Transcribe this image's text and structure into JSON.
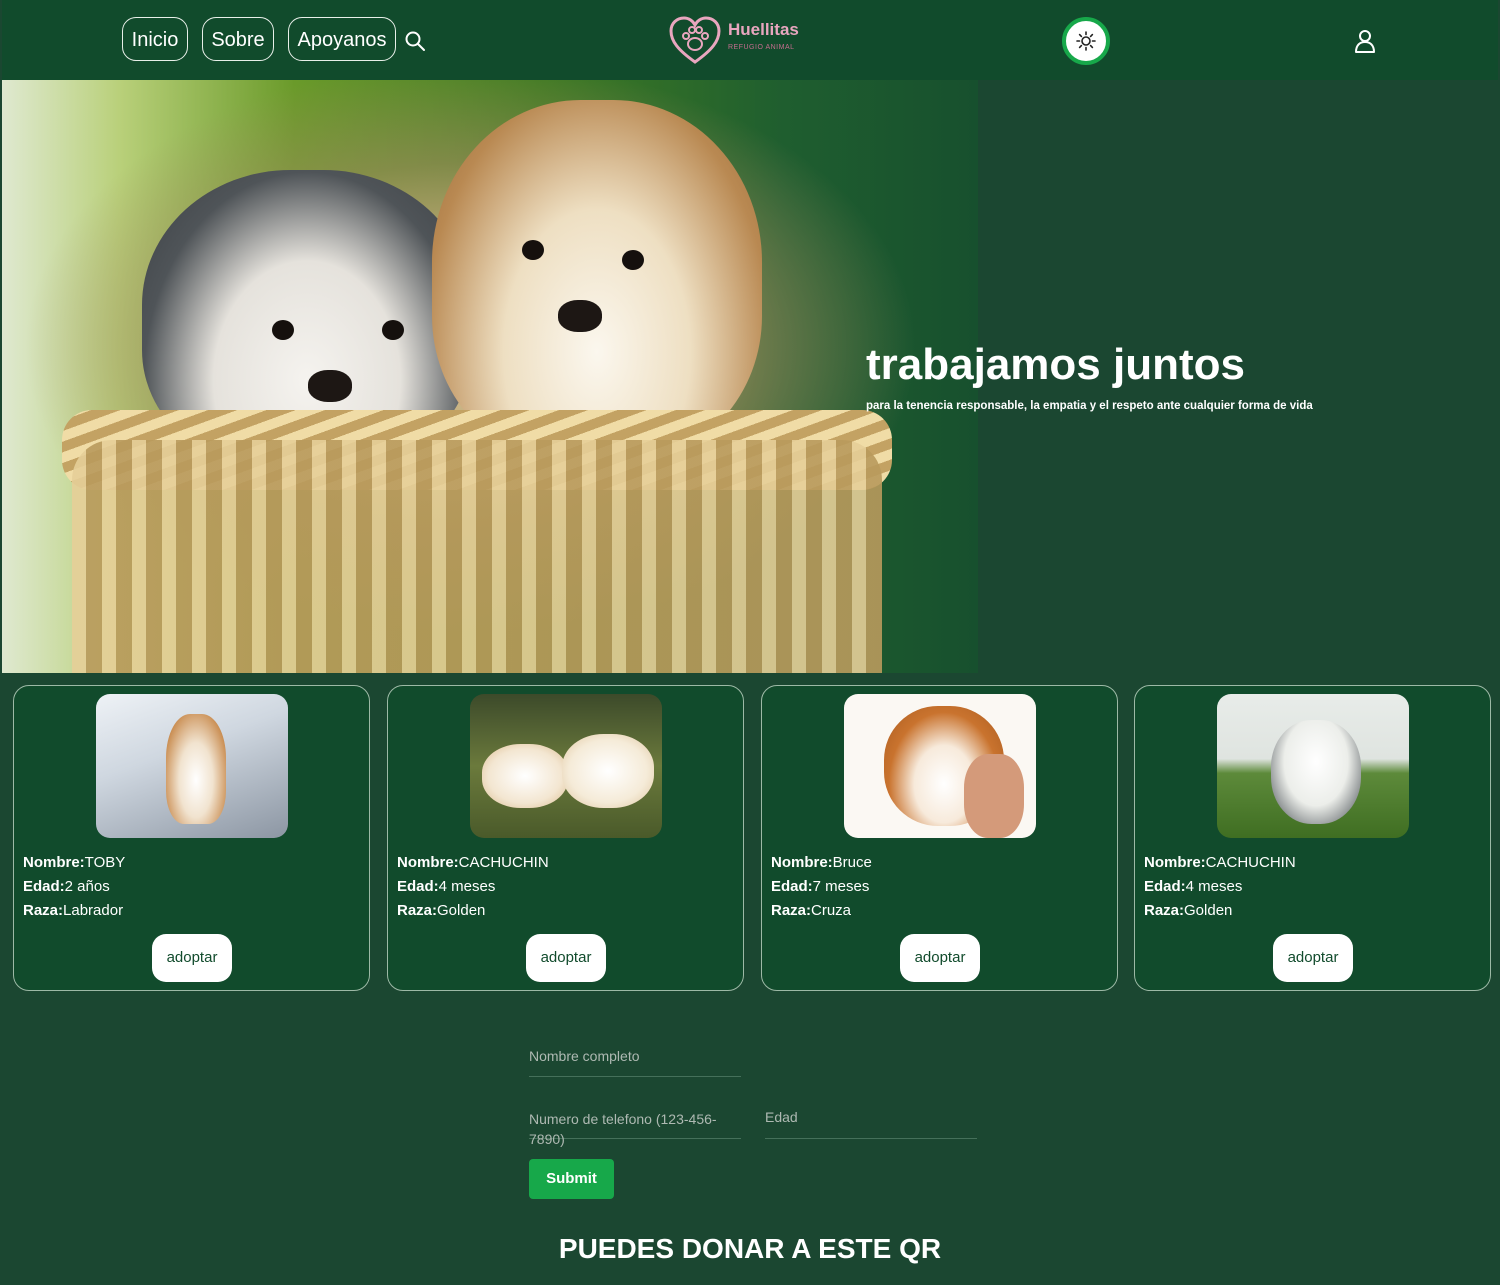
{
  "header": {
    "nav": [
      "Inicio",
      "Sobre",
      "Apoyanos"
    ],
    "logo_title": "Huellitas",
    "logo_sub": "REFUGIO ANIMAL"
  },
  "hero": {
    "title": "trabajamos juntos",
    "subtitle": "para la tenencia responsable, la empatia y el respeto ante cualquier forma de vida"
  },
  "cards": [
    {
      "name_label": "Nombre:",
      "name": "TOBY",
      "age_label": "Edad:",
      "age": "2 años",
      "breed_label": "Raza:",
      "breed": "Labrador",
      "button": "adoptar"
    },
    {
      "name_label": "Nombre:",
      "name": "CACHUCHIN",
      "age_label": "Edad:",
      "age": "4 meses",
      "breed_label": "Raza:",
      "breed": "Golden",
      "button": "adoptar"
    },
    {
      "name_label": "Nombre:",
      "name": "Bruce",
      "age_label": "Edad:",
      "age": "7 meses",
      "breed_label": "Raza:",
      "breed": "Cruza",
      "button": "adoptar"
    },
    {
      "name_label": "Nombre:",
      "name": "CACHUCHIN",
      "age_label": "Edad:",
      "age": "4 meses",
      "breed_label": "Raza:",
      "breed": "Golden",
      "button": "adoptar"
    }
  ],
  "form": {
    "name_placeholder": "Nombre completo",
    "phone_placeholder": "Numero de telefono (123-456-7890)",
    "age_placeholder": "Edad",
    "submit": "Submit"
  },
  "donate_title": "PUEDES DONAR A ESTE QR",
  "colors": {
    "header_bg": "#114b2c",
    "page_bg": "#1b4731",
    "accent": "#17a84a",
    "logo_pink": "#e9a6bf"
  }
}
